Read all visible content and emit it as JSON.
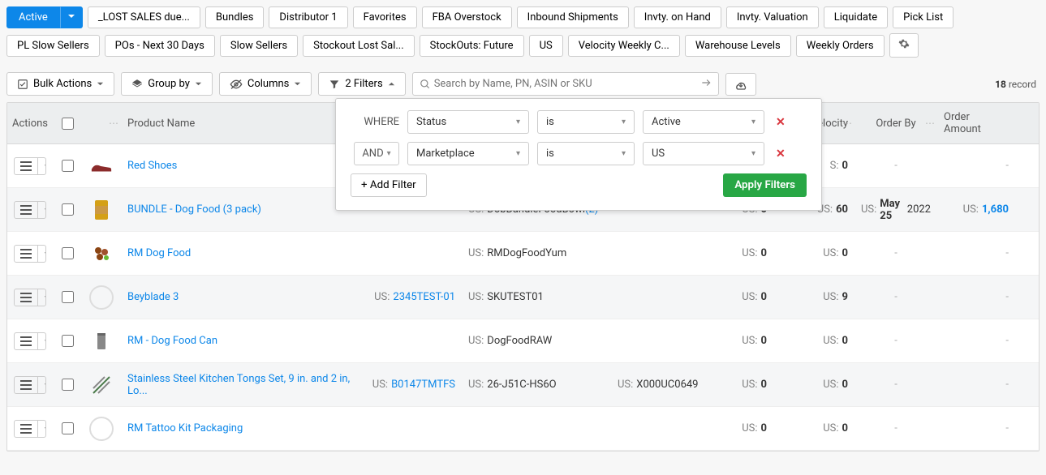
{
  "tag_rows": {
    "active_label": "Active",
    "row1": [
      "_LOST SALES due...",
      "Bundles",
      "Distributor 1",
      "Favorites",
      "FBA Overstock",
      "Inbound Shipments",
      "Invty. on Hand",
      "Invty. Valuation",
      "Liquidate",
      "Pick List"
    ],
    "row2": [
      "PL Slow Sellers",
      "POs - Next 30 Days",
      "Slow Sellers",
      "Stockout Lost Sal...",
      "StockOuts: Future",
      "US",
      "Velocity Weekly C...",
      "Warehouse Levels",
      "Weekly Orders"
    ]
  },
  "toolbar": {
    "bulk_actions": "Bulk Actions",
    "group_by": "Group by",
    "columns": "Columns",
    "filters": "2 Filters",
    "search_placeholder": "Search by Name, PN, ASIN or SKU",
    "record_count": "18",
    "record_suffix": "record"
  },
  "filter_pop": {
    "where_label": "WHERE",
    "and_label": "AND",
    "field1": "Status",
    "op1": "is",
    "val1": "Active",
    "field2": "Marketplace",
    "op2": "is",
    "val2": "US",
    "add_filter": "+ Add Filter",
    "apply": "Apply Filters"
  },
  "columns": {
    "actions": "Actions",
    "product_name": "Product Name",
    "adj_velocity": "dj. Velocity",
    "order_by": "Order By",
    "order_amount": "Order Amount"
  },
  "rows": [
    {
      "thumb_color": "#8b2b2b",
      "thumb_svg": "shoe",
      "name": "Red Shoes",
      "asin": "",
      "asin_link": false,
      "sku": "",
      "fnsku": "",
      "velocity": "",
      "adj": "S: 0",
      "adj_bold": "0",
      "order_by": "-",
      "amount": "-"
    },
    {
      "thumb_color": "#d4a017",
      "thumb_svg": "can",
      "name": "BUNDLE - Dog Food (3 pack)",
      "asin": "",
      "asin_link": false,
      "sku_prefix": "US:",
      "sku": "DobBundleFoodBowl",
      "sku_suffix": "(2)",
      "fnsku": "",
      "vel_prefix": "US:",
      "velocity": "0",
      "adj_prefix": "US:",
      "adj": "60",
      "ord_prefix": "US:",
      "order_by_bold": "May 25",
      "order_by_rest": "2022",
      "amt_prefix": "US:",
      "amount": "1,680",
      "amount_link": true,
      "alt": true
    },
    {
      "thumb_color": "#8b4513",
      "thumb_svg": "kibble",
      "name": "RM Dog Food",
      "sku_prefix": "US:",
      "sku": "RMDogFoodYum",
      "vel_prefix": "US:",
      "velocity": "0",
      "adj_prefix": "US:",
      "adj": "0",
      "order_by": "-",
      "amount": "-"
    },
    {
      "thumb_color": "#ccc",
      "thumb_svg": "placeholder",
      "name": "Beyblade 3",
      "asin_prefix": "US:",
      "asin": "2345TEST-01",
      "asin_link": true,
      "sku_prefix": "US:",
      "sku": "SKUTEST01",
      "vel_prefix": "US:",
      "velocity": "0",
      "adj_prefix": "US:",
      "adj": "9",
      "order_by": "-",
      "amount": "-",
      "alt": true
    },
    {
      "thumb_color": "#888",
      "thumb_svg": "can2",
      "name": "RM - Dog Food Can",
      "sku_prefix": "US:",
      "sku": "DogFoodRAW",
      "vel_prefix": "US:",
      "velocity": "0",
      "adj_prefix": "US:",
      "adj": "0",
      "order_by": "-",
      "amount": "-"
    },
    {
      "thumb_color": "#4a7a4a",
      "thumb_svg": "tongs",
      "name": "Stainless Steel Kitchen Tongs Set, 9 in. and 2 in, Lo...",
      "asin_prefix": "US:",
      "asin": "B0147TMTFS",
      "asin_link": true,
      "sku_prefix": "US:",
      "sku": "26-J51C-HS6O",
      "fnsku_prefix": "US:",
      "fnsku": "X000UC0649",
      "vel_prefix": "US:",
      "velocity": "0",
      "adj_prefix": "US:",
      "adj": "0",
      "order_by": "-",
      "amount": "-",
      "alt": true
    },
    {
      "thumb_color": "#ccc",
      "thumb_svg": "placeholder",
      "name": "RM Tattoo Kit Packaging",
      "vel_prefix": "US:",
      "velocity": "0",
      "adj_prefix": "US:",
      "adj": "0",
      "order_by": "-",
      "amount": "-"
    }
  ]
}
